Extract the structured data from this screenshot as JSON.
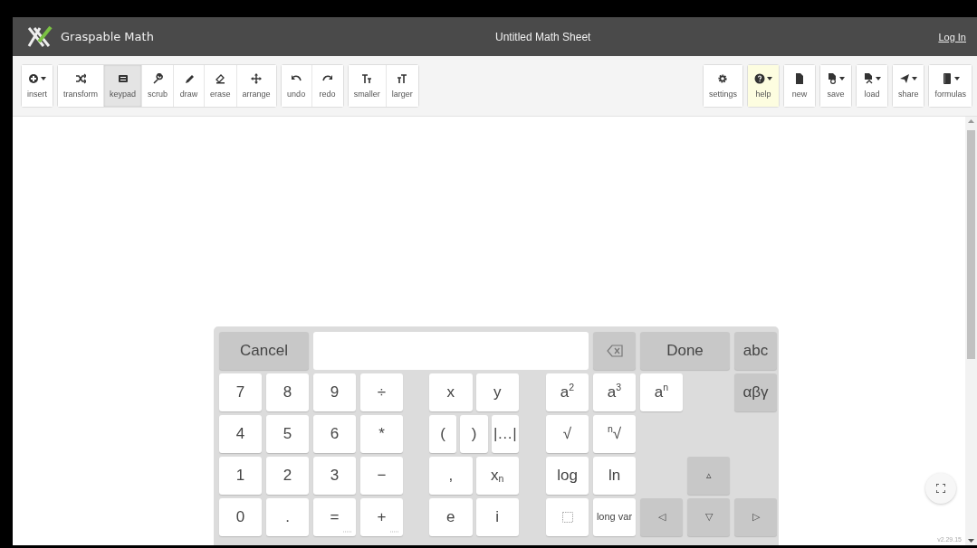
{
  "header": {
    "app_name": "Graspable Math",
    "title": "Untitled Math Sheet",
    "login": "Log In"
  },
  "toolbar": {
    "left_groups": [
      [
        {
          "label": "insert",
          "dropdown": true,
          "selected": false,
          "highlighted": false
        }
      ],
      [
        {
          "label": "transform",
          "dropdown": false,
          "selected": false,
          "highlighted": false
        },
        {
          "label": "keypad",
          "dropdown": false,
          "selected": true,
          "highlighted": false
        },
        {
          "label": "scrub",
          "dropdown": false,
          "selected": false,
          "highlighted": false
        },
        {
          "label": "draw",
          "dropdown": false,
          "selected": false,
          "highlighted": false
        },
        {
          "label": "erase",
          "dropdown": false,
          "selected": false,
          "highlighted": false
        },
        {
          "label": "arrange",
          "dropdown": false,
          "selected": false,
          "highlighted": false
        }
      ],
      [
        {
          "label": "undo",
          "dropdown": false,
          "selected": false,
          "highlighted": false
        },
        {
          "label": "redo",
          "dropdown": false,
          "selected": false,
          "highlighted": false
        }
      ],
      [
        {
          "label": "smaller",
          "dropdown": false,
          "selected": false,
          "highlighted": false
        },
        {
          "label": "larger",
          "dropdown": false,
          "selected": false,
          "highlighted": false
        }
      ]
    ],
    "right_buttons": [
      {
        "label": "settings",
        "dropdown": false,
        "selected": false,
        "highlighted": false
      },
      {
        "label": "help",
        "dropdown": true,
        "selected": false,
        "highlighted": true
      },
      {
        "label": "new",
        "dropdown": false,
        "selected": false,
        "highlighted": false
      },
      {
        "label": "save",
        "dropdown": true,
        "selected": false,
        "highlighted": false
      },
      {
        "label": "load",
        "dropdown": true,
        "selected": false,
        "highlighted": false
      },
      {
        "label": "share",
        "dropdown": true,
        "selected": false,
        "highlighted": false
      },
      {
        "label": "formulas",
        "dropdown": true,
        "selected": false,
        "highlighted": false
      }
    ]
  },
  "keypad": {
    "top_bar": [
      {
        "kind": "wide",
        "label": "Cancel",
        "grey": true
      },
      {
        "kind": "field"
      },
      {
        "kind": "backspace",
        "grey": true
      },
      {
        "kind": "wide",
        "label": "Done",
        "grey": true
      },
      {
        "kind": "key",
        "label": "abc",
        "grey": true
      }
    ],
    "digits": [
      {
        "kind": "key",
        "label": "7"
      },
      {
        "kind": "key",
        "label": "8"
      },
      {
        "kind": "key",
        "label": "9"
      },
      {
        "kind": "key",
        "label": "÷"
      },
      {
        "kind": "key",
        "label": "4"
      },
      {
        "kind": "key",
        "label": "5"
      },
      {
        "kind": "key",
        "label": "6"
      },
      {
        "kind": "key",
        "label": "*"
      },
      {
        "kind": "key",
        "label": "1"
      },
      {
        "kind": "key",
        "label": "2"
      },
      {
        "kind": "key",
        "label": "3"
      },
      {
        "kind": "key",
        "label": "−"
      },
      {
        "kind": "key",
        "label": "0"
      },
      {
        "kind": "key",
        "label": "."
      },
      {
        "kind": "key",
        "label": "=",
        "more": true
      },
      {
        "kind": "key",
        "label": "+",
        "more": true
      }
    ],
    "variables": [
      {
        "kind": "key",
        "label": "x"
      },
      {
        "kind": "key",
        "label": "y"
      },
      {
        "kind": "narrow",
        "label": "("
      },
      {
        "kind": "narrow",
        "label": ")"
      },
      {
        "kind": "narrow",
        "label": "|…|"
      },
      {
        "kind": "key",
        "label": ","
      },
      {
        "kind": "key",
        "label": "x$_{n}$"
      },
      {
        "kind": "key",
        "label": "e"
      },
      {
        "kind": "key",
        "label": "i"
      }
    ],
    "functions": [
      {
        "kind": "key",
        "label": "a$^{2}$"
      },
      {
        "kind": "key",
        "label": "a$^{3}$"
      },
      {
        "kind": "key",
        "label": "a$^{n}$"
      },
      {
        "kind": "space"
      },
      {
        "kind": "key",
        "label": "αβγ",
        "grey": true
      },
      {
        "kind": "key",
        "label": "√"
      },
      {
        "kind": "key",
        "label": "$^{n}$√"
      },
      {
        "kind": "space"
      },
      {
        "kind": "space"
      },
      {
        "kind": "space"
      },
      {
        "kind": "key",
        "label": "log"
      },
      {
        "kind": "key",
        "label": "ln"
      },
      {
        "kind": "space"
      },
      {
        "kind": "key",
        "label": "▵",
        "grey": true,
        "small": true
      },
      {
        "kind": "space"
      },
      {
        "kind": "slot"
      },
      {
        "kind": "key",
        "label": "long var",
        "small": true
      },
      {
        "kind": "key",
        "label": "◁",
        "grey": true,
        "small": true
      },
      {
        "kind": "key",
        "label": "▽",
        "grey": true,
        "small": true
      },
      {
        "kind": "key",
        "label": "▷",
        "grey": true,
        "small": true
      }
    ]
  },
  "version": "v2.29.15"
}
